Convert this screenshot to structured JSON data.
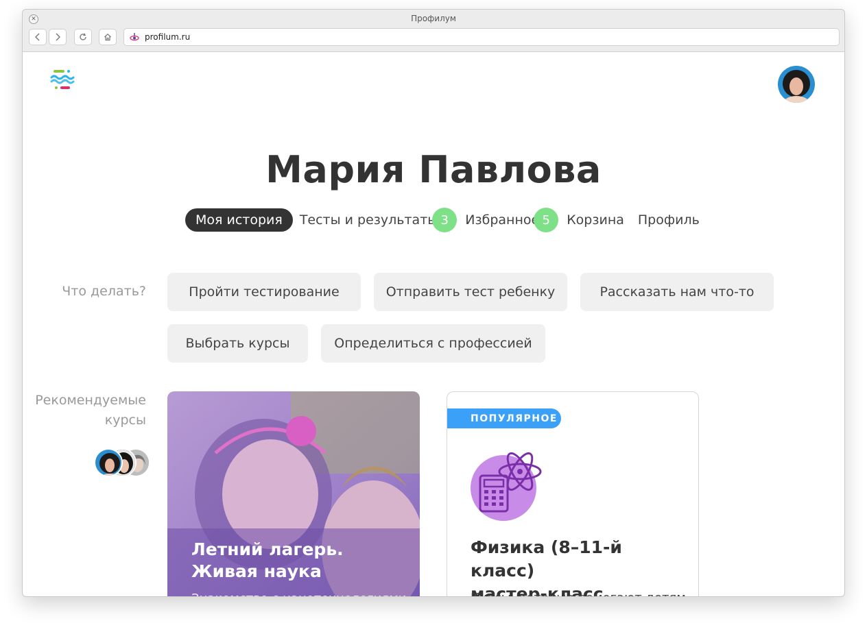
{
  "browser": {
    "window_title": "Профилум",
    "url": "profilum.ru",
    "close_glyph": "✕"
  },
  "profile": {
    "name": "Мария Павлова"
  },
  "tabs": [
    {
      "label": "Моя история",
      "active": true
    },
    {
      "label": "Тесты и результаты",
      "badge": "3"
    },
    {
      "label": "Избранное",
      "badge": "5"
    },
    {
      "label": "Корзина"
    },
    {
      "label": "Профиль"
    }
  ],
  "actions": {
    "label": "Что делать?",
    "buttons": [
      "Пройти тестирование",
      "Отправить тест ребенку",
      "Рассказать нам что-то",
      "Выбрать курсы",
      "Определиться с профессией"
    ]
  },
  "recommended": {
    "label_line1": "Рекомендуемые",
    "label_line2": "курсы"
  },
  "courses": [
    {
      "title_line1": "Летний лагерь.",
      "title_line2": "Живая наука",
      "subtitle": "Знакомство с нанотехнологиями,"
    },
    {
      "badge": "ПОПУЛЯРНОЕ",
      "icon": "atom-calculator-icon",
      "title_line1": "Физика (8–11-й класс)",
      "title_line2": "мастер-класс",
      "description": "Курсы, которые помогают детям"
    }
  ],
  "colors": {
    "badge_green": "#7ee087",
    "popular_blue": "#3ba0f7",
    "icon_purple": "#c98be8",
    "tab_active_bg": "#333333"
  }
}
